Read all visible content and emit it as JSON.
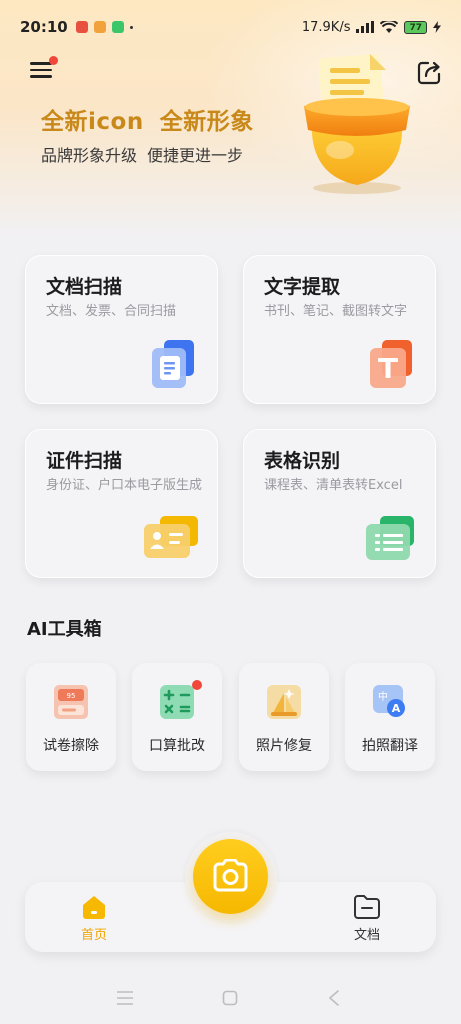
{
  "status_bar": {
    "time": "20:10",
    "network_speed": "17.9K/s",
    "battery_level": "77"
  },
  "hero": {
    "title_part1": "全新icon",
    "title_part2": "全新形象",
    "subtitle_part1": "品牌形象升级",
    "subtitle_part2": "便捷更进一步"
  },
  "features": [
    {
      "title": "文档扫描",
      "desc": "文档、发票、合同扫描",
      "icon": "document-scan-icon"
    },
    {
      "title": "文字提取",
      "desc": "书刊、笔记、截图转文字",
      "icon": "text-extract-icon"
    },
    {
      "title": "证件扫描",
      "desc": "身份证、户口本电子版生成",
      "icon": "id-card-scan-icon"
    },
    {
      "title": "表格识别",
      "desc": "课程表、清单表转Excel",
      "icon": "table-recognize-icon"
    }
  ],
  "ai_toolbox": {
    "title": "AI工具箱",
    "tools": [
      {
        "label": "试卷擦除",
        "icon": "exam-erase-icon"
      },
      {
        "label": "口算批改",
        "icon": "calc-check-icon"
      },
      {
        "label": "照片修复",
        "icon": "photo-repair-icon"
      },
      {
        "label": "拍照翻译",
        "icon": "photo-translate-icon"
      }
    ]
  },
  "tabbar": {
    "home_label": "首页",
    "docs_label": "文档"
  },
  "colors": {
    "accent": "#f6b800",
    "hero_title": "#c8891a",
    "badge": "#f0473a"
  }
}
